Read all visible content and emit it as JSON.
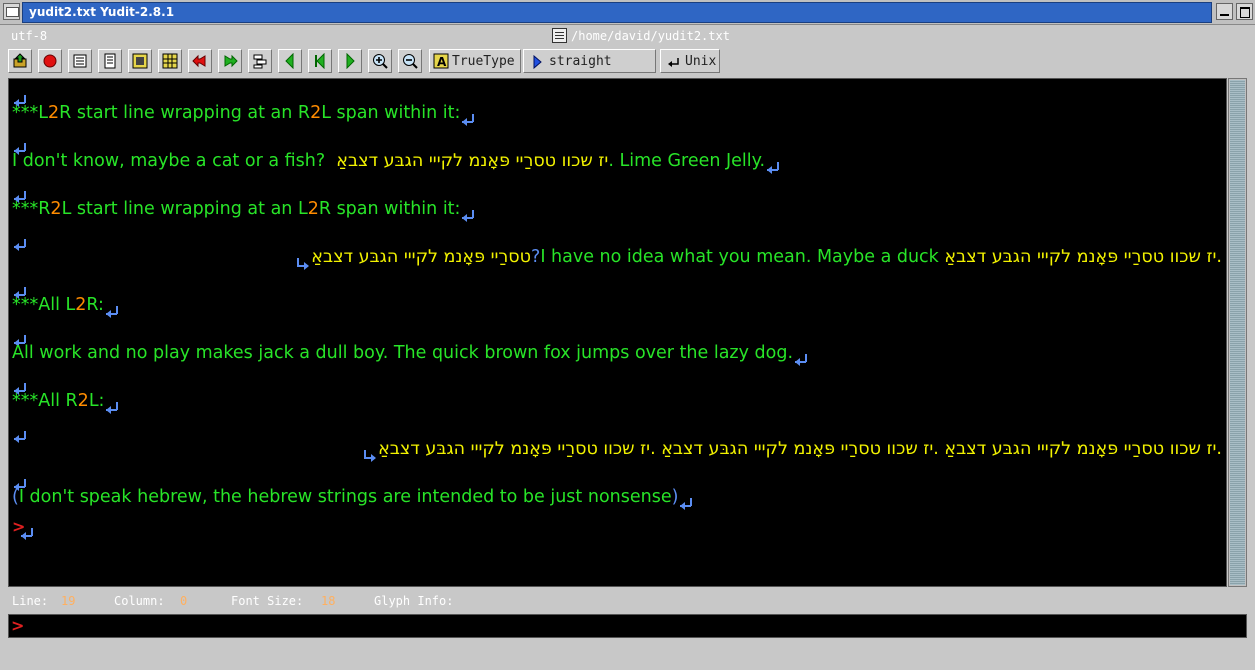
{
  "window": {
    "title": "yudit2.txt  Yudit-2.8.1"
  },
  "header": {
    "encoding": "utf-8",
    "file_path": "/home/david/yudit2.txt"
  },
  "toolbar": {
    "font_label": "TrueType",
    "direction_label": "straight",
    "line_ending_label": "Unix",
    "icons": [
      "open-icon",
      "record-icon",
      "print-icon",
      "print-preview-icon",
      "keyboard-icon",
      "grid-icon",
      "undo-icon",
      "redo-icon",
      "layout-icon",
      "first-icon",
      "previous-icon",
      "next-icon",
      "zoom-in-icon",
      "zoom-out-icon",
      "font-icon",
      "direction-icon",
      "line-ending-icon"
    ]
  },
  "editor": {
    "line1_stars": "***",
    "line1_a": "L",
    "line1_b": "2",
    "line1_c": "R start line wrapping at an R",
    "line1_d": "2",
    "line1_e": "L span within it:",
    "line2_a": "I don't know, maybe a cat or a fish?",
    "line2_heb": "יז שכוו טסרַיי פּאָנמ לקייי הגבּע דצבאַ",
    "line2_c": ". Lime Green Jelly.",
    "line3_stars": "***",
    "line3_a": "R",
    "line3_b": "2",
    "line3_c": "L start line wrapping at an L",
    "line3_d": "2",
    "line3_e": "R span within it:",
    "line4_heb1": "טסרַיי פּאָנמ לקייי הגבּע דצבאַ",
    "line4_q": "?",
    "line4_eng": "I have no idea what you mean. Maybe a duck",
    "line4_heb2": ".יז שכוו טסרַיי פּאָנמ לקייי הגבּע דצבאַ",
    "line5_stars": "***",
    "line5_a": "All L",
    "line5_b": "2",
    "line5_c": "R:",
    "line6": "All work and no play makes jack a dull boy. The quick brown fox jumps over the lazy dog.",
    "line7_stars": "***",
    "line7_a": "All R",
    "line7_b": "2",
    "line7_c": "L:",
    "line8_heb": ".יז שכוו טסרַיי פּאָנמ לקייי הגבּע דצבאַ .יז שכוו טסרַיי פּאָנמ לקייי הגבּע דצבאַ .יז שכוו טסרַיי פּאָנמ לקייי הגבּע דצבאַ",
    "line9_open": "(",
    "line9_text": "I don't speak hebrew, the hebrew strings are intended to be just nonsense",
    "line9_close": ")"
  },
  "status": {
    "line_label": "Line:",
    "line_value": "19",
    "column_label": "Column:",
    "column_value": "0",
    "font_size_label": "Font Size:",
    "font_size_value": "18",
    "glyph_info_label": "Glyph Info:"
  },
  "colors": {
    "text_green": "#28e428",
    "digit_orange": "#ff8c00",
    "hebrew_yellow": "#f2f200",
    "marker_blue": "#5b8df2",
    "title_blue": "#2f66c4"
  }
}
